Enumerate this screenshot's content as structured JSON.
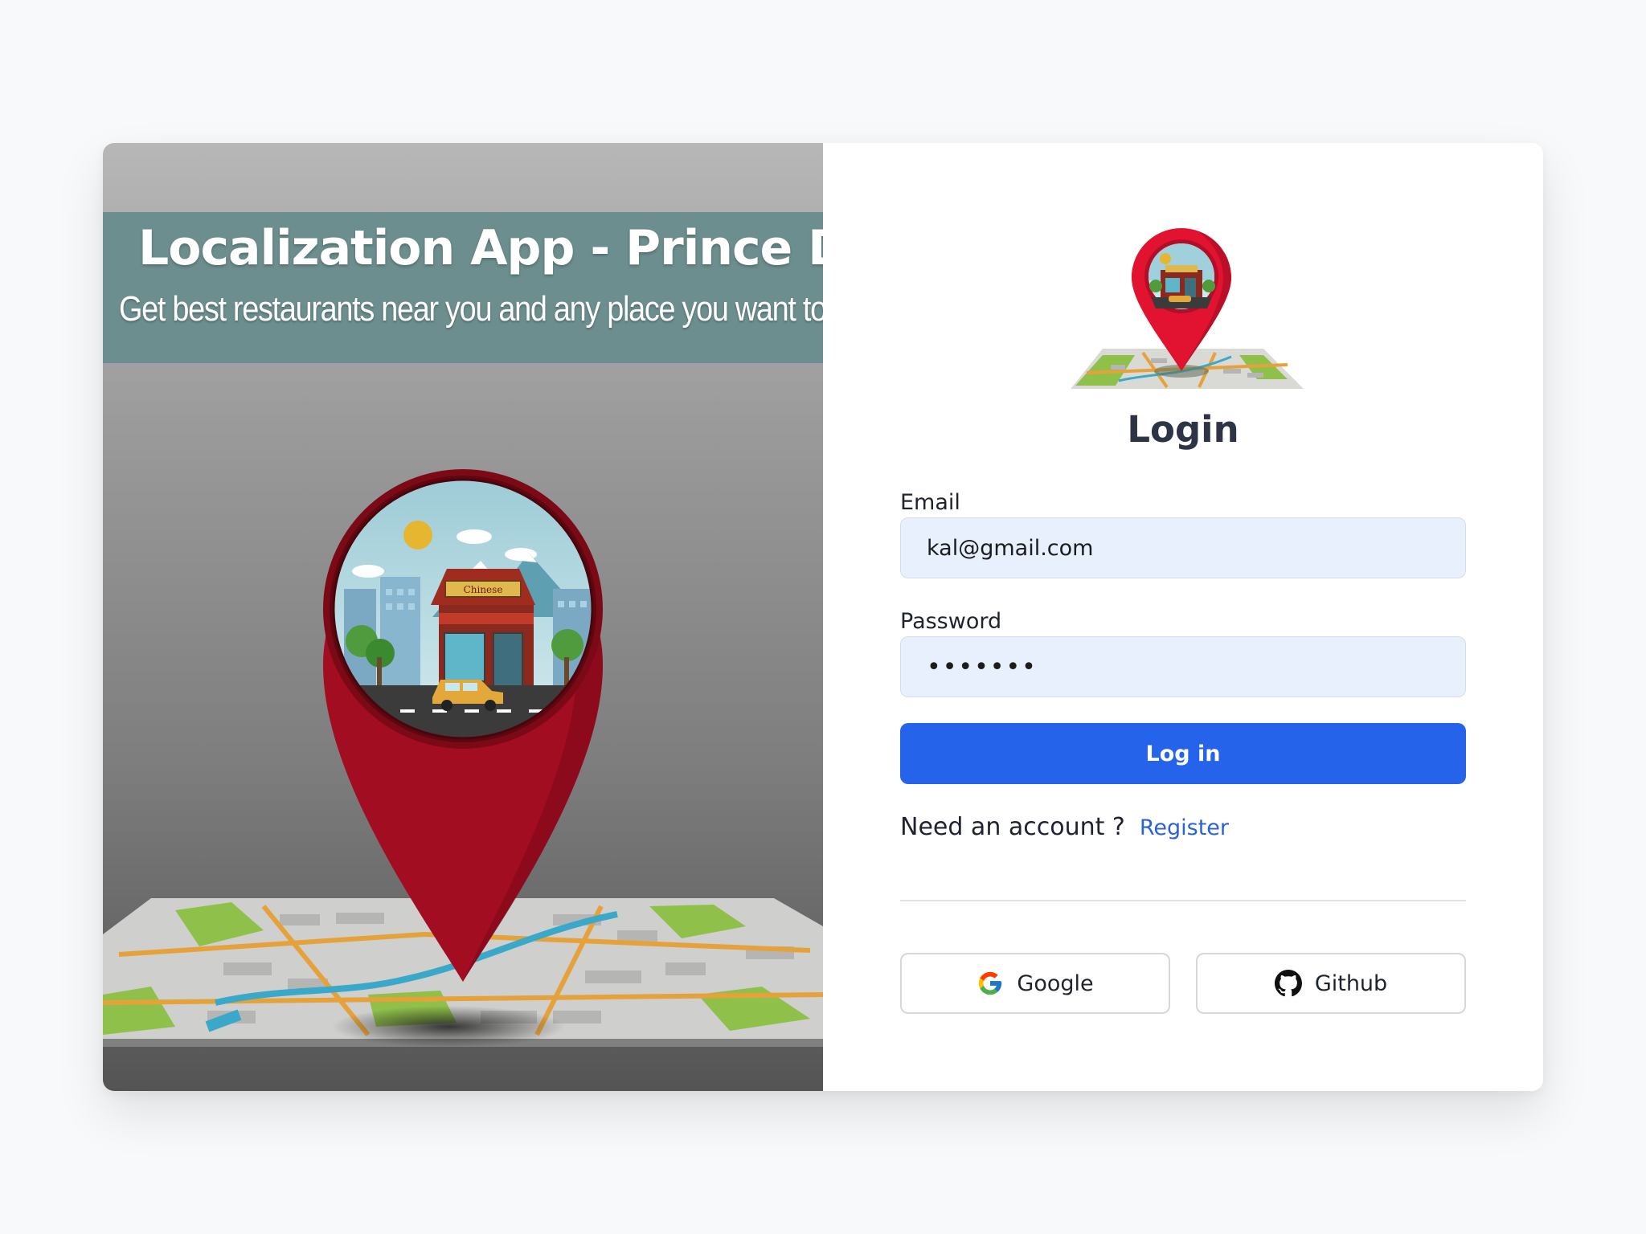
{
  "hero": {
    "title": "Localization App - Prince Dev",
    "subtitle": "Get best restaurants near you and any place you want to visi",
    "shop_sign": "Chinese"
  },
  "form": {
    "title": "Login",
    "email": {
      "label": "Email",
      "value": "kal@gmail.com"
    },
    "password": {
      "label": "Password",
      "value": "•••••••"
    },
    "submit_label": "Log in",
    "account_prompt": "Need an account ?",
    "register_label": "Register",
    "social": {
      "google_label": "Google",
      "github_label": "Github"
    }
  },
  "colors": {
    "primary": "#2563eb",
    "link": "#2b62d9",
    "input_bg": "#e8f0fe",
    "pin_red": "#c30f2a",
    "banner": "#6d8e8e"
  },
  "icons": [
    "map-pin-icon",
    "google-icon",
    "github-icon"
  ]
}
